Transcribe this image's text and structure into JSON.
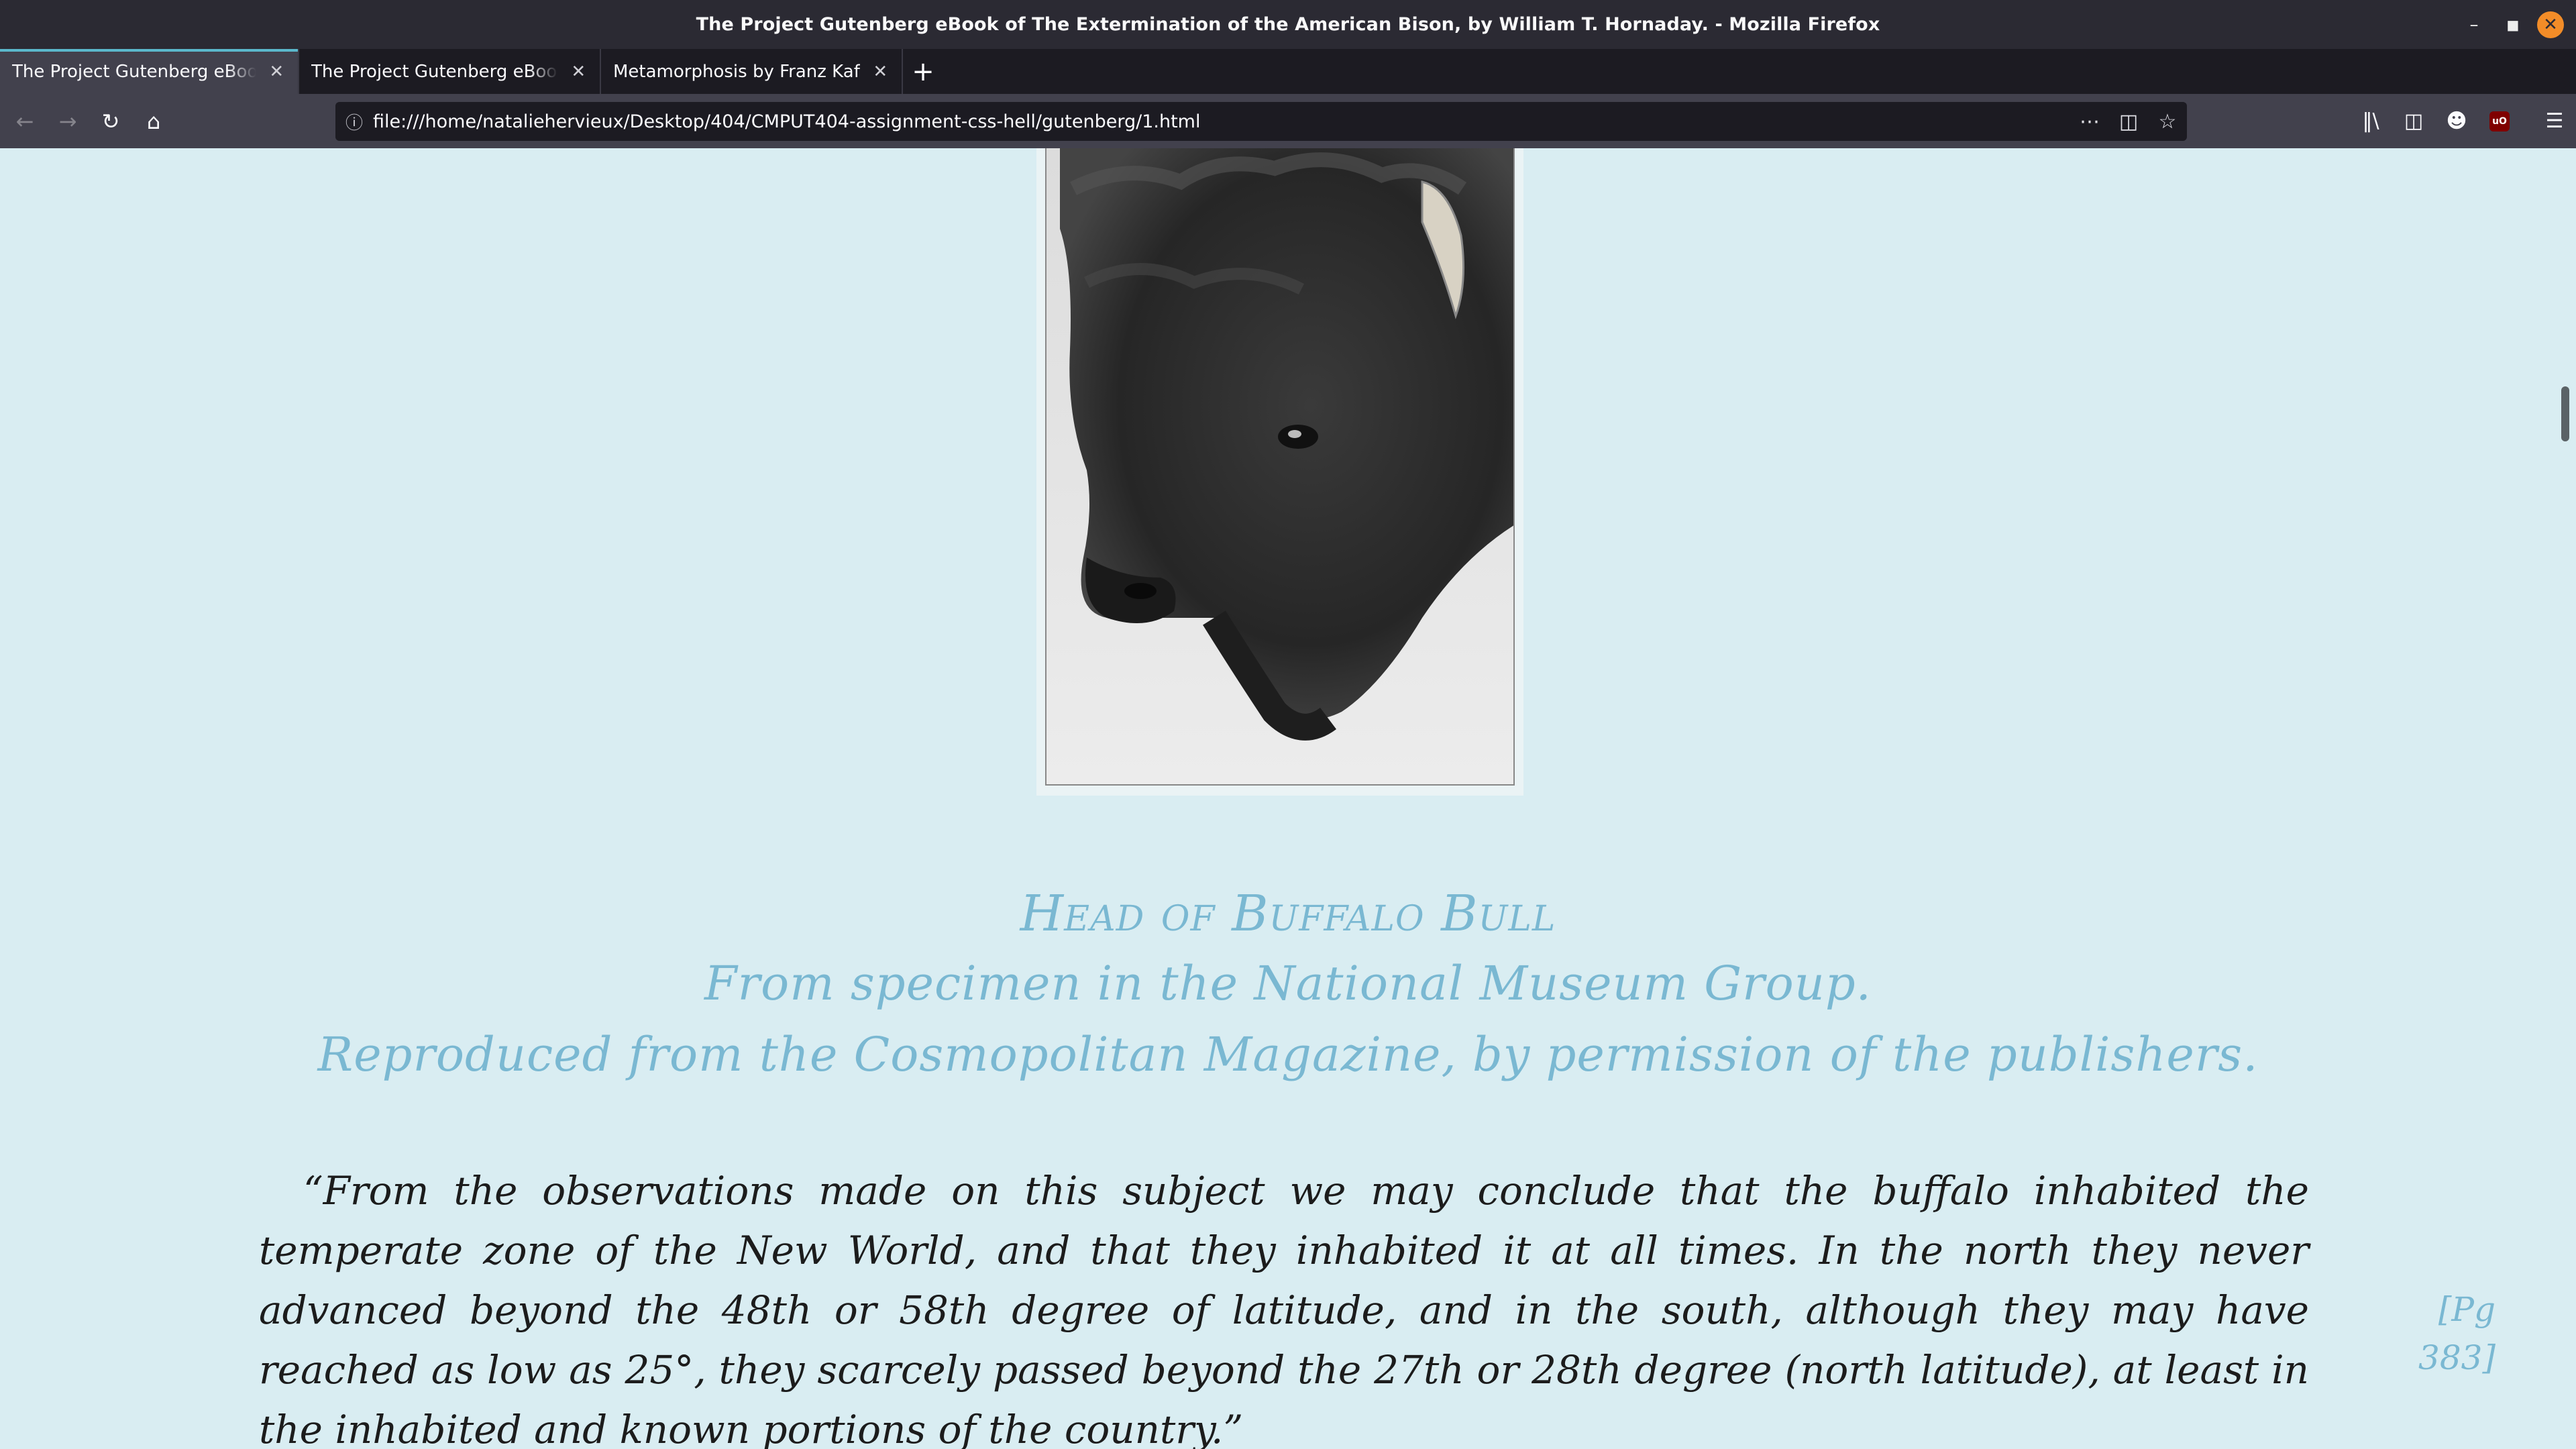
{
  "window": {
    "title": "The Project Gutenberg eBook of The Extermination of the American Bison, by William T. Hornaday. - Mozilla Firefox"
  },
  "tabs": [
    {
      "label": "The Project Gutenberg eBook of The Extermination of the American Bison",
      "active": true
    },
    {
      "label": "The Project Gutenberg eBook of The Extermination of the American Bison",
      "active": false
    },
    {
      "label": "Metamorphosis by Franz Kafka",
      "active": false
    }
  ],
  "navbar": {
    "url": "file:///home/natalieherviеux/Desktop/404/CMPUT404-assignment-css-hell/gutenberg/1.html"
  },
  "figure": {
    "caption_title": "Head of Buffalo Bull",
    "caption_line2": "From specimen in the National Museum Group.",
    "caption_line3": "Reproduced from the Cosmopolitan Magazine, by permission of the publishers."
  },
  "body": {
    "quote": "“From the observations made on this subject we may conclude that the buffalo inhabited the temperate zone of the New World, and that they inhabited it at all times. In the north they never advanced beyond the 48th or 58th degree of latitude, and in the south, although they may have reached as low as 25°, they scarcely passed beyond the 27th or 28th degree (north latitude), at least in the inhabited and known portions of the country.”",
    "page_marker": "[Pg 383]"
  },
  "colors": {
    "page_background": "#d9edf2",
    "caption": "#7ab8d2",
    "tab_accent": "#5bb8cc"
  }
}
